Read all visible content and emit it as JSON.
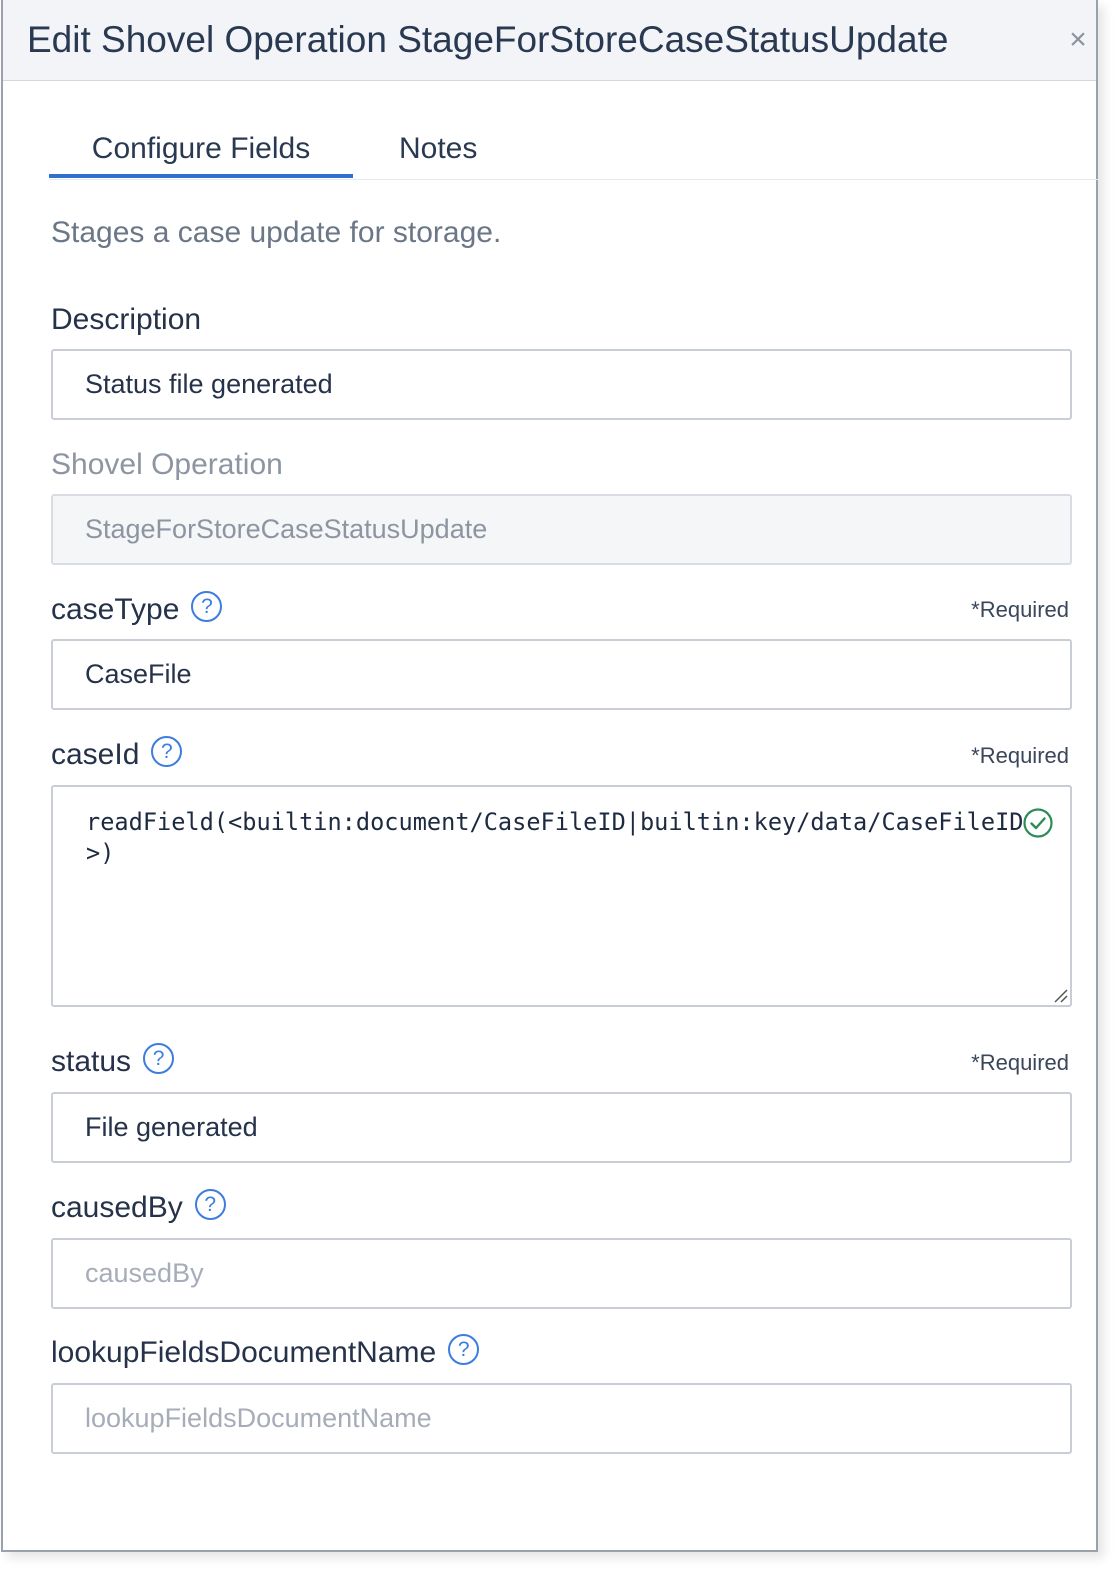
{
  "dialog": {
    "title": "Edit Shovel Operation StageForStoreCaseStatusUpdate",
    "close_label": "×"
  },
  "tabs": [
    {
      "label": "Configure Fields",
      "active": true
    },
    {
      "label": "Notes",
      "active": false
    }
  ],
  "operation_description": "Stages a case update for storage.",
  "fields": {
    "description": {
      "label": "Description",
      "value": "Status file generated"
    },
    "shovel_operation": {
      "label": "Shovel Operation",
      "value": "StageForStoreCaseStatusUpdate"
    },
    "case_type": {
      "label": "caseType",
      "help": "?",
      "required": "*Required",
      "value": "CaseFile"
    },
    "case_id": {
      "label": "caseId",
      "help": "?",
      "required": "*Required",
      "value": "readField(<builtin:document/CaseFileID|builtin:key/data/CaseFileID>)"
    },
    "status": {
      "label": "status",
      "help": "?",
      "required": "*Required",
      "value": "File generated"
    },
    "caused_by": {
      "label": "causedBy",
      "help": "?",
      "placeholder": "causedBy"
    },
    "lookup_fields_document_name": {
      "label": "lookupFieldsDocumentName",
      "help": "?",
      "placeholder": "lookupFieldsDocumentName"
    }
  },
  "colors": {
    "accent": "#2f6fd1",
    "help_icon": "#3d7ce0",
    "valid_check": "#2e8b57"
  },
  "icons": [
    "close-icon",
    "help-icon",
    "check-circle-icon",
    "resize-handle-icon"
  ]
}
